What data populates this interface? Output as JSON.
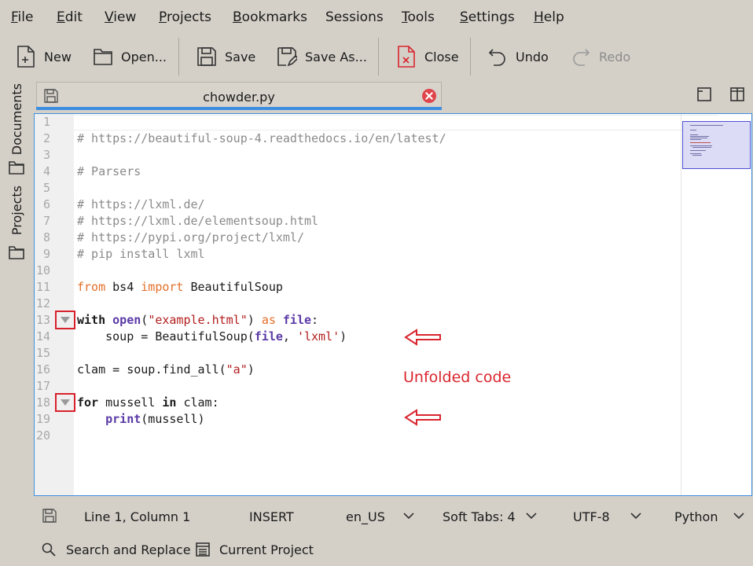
{
  "menu": [
    {
      "mnemonic": "F",
      "rest": "ile"
    },
    {
      "mnemonic": "E",
      "rest": "dit"
    },
    {
      "mnemonic": "V",
      "rest": "iew"
    },
    {
      "mnemonic": "P",
      "rest": "rojects"
    },
    {
      "mnemonic": "B",
      "rest": "ookmarks"
    },
    {
      "mnemonic": "S",
      "rest": "essions"
    },
    {
      "mnemonic": "T",
      "rest": "ools"
    },
    {
      "mnemonic": "S",
      "rest": "ettings"
    },
    {
      "mnemonic": "H",
      "rest": "elp"
    }
  ],
  "menu_plain": [
    "Sessions"
  ],
  "toolbar": {
    "new": "New",
    "open": "Open...",
    "save": "Save",
    "save_as": "Save As...",
    "close": "Close",
    "undo": "Undo",
    "redo": "Redo"
  },
  "side_panel": {
    "documents": "Documents",
    "projects": "Projects"
  },
  "tab": {
    "title": "chowder.py"
  },
  "editor": {
    "line_numbers": [
      "1",
      "2",
      "3",
      "4",
      "5",
      "6",
      "7",
      "8",
      "9",
      "10",
      "11",
      "12",
      "13",
      "14",
      "15",
      "16",
      "17",
      "18",
      "19",
      "20"
    ],
    "lines": {
      "l2": "# https://beautiful-soup-4.readthedocs.io/en/latest/",
      "l4": "# Parsers",
      "l6": "# https://lxml.de/",
      "l7": "# https://lxml.de/elementsoup.html",
      "l8": "# https://pypi.org/project/lxml/",
      "l9": "# pip install lxml",
      "l11_kw1": "from",
      "l11_mid": " bs4 ",
      "l11_kw2": "import",
      "l11_end": " BeautifulSoup",
      "l13_kw": "with",
      "l13_sp": " ",
      "l13_fn": "open",
      "l13_p1": "(",
      "l13_str": "\"example.html\"",
      "l13_p2": ") ",
      "l13_as": "as",
      "l13_sp2": " ",
      "l13_file": "file",
      "l13_colon": ":",
      "l14_pre": "    soup = BeautifulSoup(",
      "l14_file": "file",
      "l14_comma": ", ",
      "l14_str": "'lxml'",
      "l14_end": ")",
      "l16_pre": "clam = soup.find_all(",
      "l16_str": "\"a\"",
      "l16_end": ")",
      "l18_kw": "for",
      "l18_mid": " mussell ",
      "l18_in": "in",
      "l18_end": " clam:",
      "l19_pre": "    ",
      "l19_fn": "print",
      "l19_end": "(mussell)"
    }
  },
  "annotation": "Unfolded code",
  "status": {
    "position": "Line 1, Column 1",
    "mode": "INSERT",
    "language": "en_US",
    "tabs": "Soft Tabs: 4",
    "encoding": "UTF-8",
    "syntax": "Python"
  },
  "bottom": {
    "search": "Search and Replace",
    "project": "Current Project"
  },
  "colors": {
    "accent": "#3d8ee0",
    "annotation": "#d9252e",
    "keyword": "#e36f2a",
    "builtin": "#5b3aa6",
    "string": "#b21e1e"
  }
}
